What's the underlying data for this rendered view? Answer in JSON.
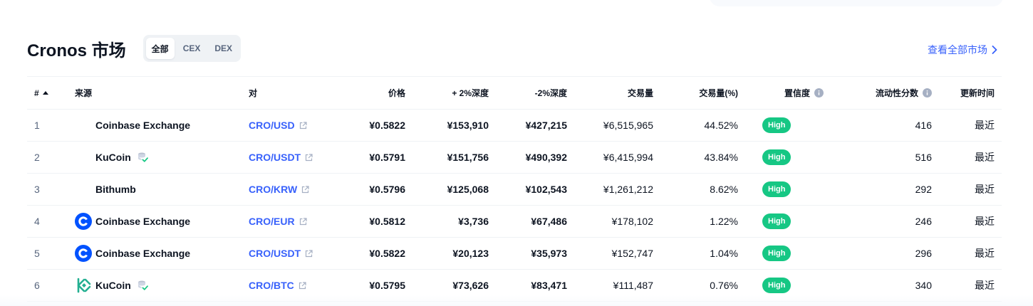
{
  "header": {
    "title": "Cronos 市场",
    "tabs": [
      {
        "label": "全部",
        "active": true
      },
      {
        "label": "CEX",
        "active": false
      },
      {
        "label": "DEX",
        "active": false
      }
    ],
    "view_all": "查看全部市场"
  },
  "table": {
    "columns": {
      "rank": "#",
      "source": "来源",
      "pair": "对",
      "price": "价格",
      "plus2": "+ 2%深度",
      "minus2": "-2%深度",
      "volume": "交易量",
      "volume_pct": "交易量(%)",
      "confidence": "置信度",
      "liquidity": "流动性分数",
      "updated": "更新时间"
    },
    "rows": [
      {
        "rank": "1",
        "source": "Coinbase Exchange",
        "logo": "none",
        "badge": false,
        "pair": "CRO/USD",
        "price": "¥0.5822",
        "plus2": "¥153,910",
        "minus2": "¥427,215",
        "volume": "¥6,515,965",
        "volume_pct": "44.52%",
        "confidence": "High",
        "liquidity": "416",
        "updated": "最近"
      },
      {
        "rank": "2",
        "source": "KuCoin",
        "logo": "none",
        "badge": true,
        "pair": "CRO/USDT",
        "price": "¥0.5791",
        "plus2": "¥151,756",
        "minus2": "¥490,392",
        "volume": "¥6,415,994",
        "volume_pct": "43.84%",
        "confidence": "High",
        "liquidity": "516",
        "updated": "最近"
      },
      {
        "rank": "3",
        "source": "Bithumb",
        "logo": "none",
        "badge": false,
        "pair": "CRO/KRW",
        "price": "¥0.5796",
        "plus2": "¥125,068",
        "minus2": "¥102,543",
        "volume": "¥1,261,212",
        "volume_pct": "8.62%",
        "confidence": "High",
        "liquidity": "292",
        "updated": "最近"
      },
      {
        "rank": "4",
        "source": "Coinbase Exchange",
        "logo": "coinbase-logo-icon",
        "badge": false,
        "pair": "CRO/EUR",
        "price": "¥0.5812",
        "plus2": "¥3,736",
        "minus2": "¥67,486",
        "volume": "¥178,102",
        "volume_pct": "1.22%",
        "confidence": "High",
        "liquidity": "246",
        "updated": "最近"
      },
      {
        "rank": "5",
        "source": "Coinbase Exchange",
        "logo": "coinbase-logo-icon",
        "badge": false,
        "pair": "CRO/USDT",
        "price": "¥0.5822",
        "plus2": "¥20,123",
        "minus2": "¥35,973",
        "volume": "¥152,747",
        "volume_pct": "1.04%",
        "confidence": "High",
        "liquidity": "296",
        "updated": "最近"
      },
      {
        "rank": "6",
        "source": "KuCoin",
        "logo": "kucoin-logo-icon",
        "badge": true,
        "pair": "CRO/BTC",
        "price": "¥0.5795",
        "plus2": "¥73,626",
        "minus2": "¥83,471",
        "volume": "¥111,487",
        "volume_pct": "0.76%",
        "confidence": "High",
        "liquidity": "340",
        "updated": "最近"
      }
    ]
  },
  "colors": {
    "link": "#3861fb",
    "high_pill": "#16c784",
    "text": "#0d1421",
    "muted": "#58667e",
    "coinbase": "#0052ff",
    "kucoin": "#23af91"
  }
}
